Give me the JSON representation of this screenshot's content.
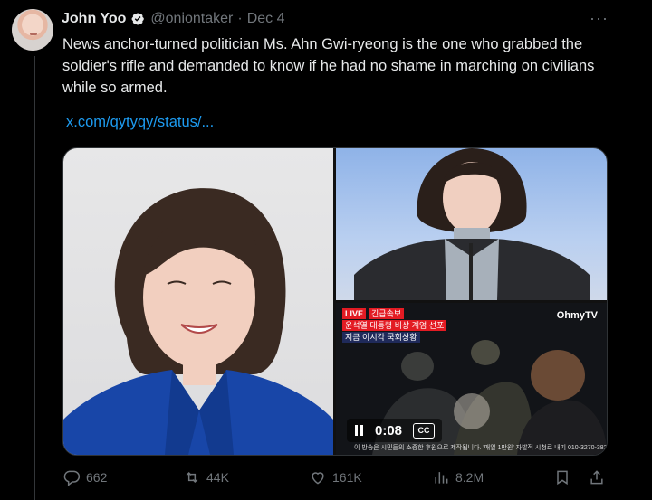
{
  "tweet": {
    "display_name": "John Yoo",
    "handle": "@oniontaker",
    "separator": "·",
    "date": "Dec 4",
    "more_label": "···",
    "text": "News anchor-turned politician Ms. Ahn Gwi-ryeong is the one who grabbed the soldier's rifle and demanded to know if he had no shame in marching on civilians while so armed.",
    "link": "x.com/qytyqy/status/..."
  },
  "media": {
    "broadcast": {
      "live_label": "LIVE",
      "breaking_label": "긴급속보",
      "headline": "윤석열 대통령 비상 계엄 선포",
      "subline": "지금 이시각 국회상황",
      "channel": "OhmyTV",
      "ticker": "이 방송은 시민들의 소중한 후원으로 제작됩니다. '매일 1만원' 자발적 시청료 내기 010-3270-3828"
    },
    "video": {
      "time": "0:08",
      "cc_label": "CC"
    }
  },
  "actions": {
    "replies": "662",
    "reposts": "44K",
    "likes": "161K",
    "views": "8.2M"
  },
  "colors": {
    "background": "#000000",
    "text": "#e7e9ea",
    "muted": "#71767b",
    "link": "#1d9bf0",
    "live_red": "#e31b23"
  },
  "icons": [
    "verified-badge-icon",
    "more-icon",
    "pause-icon",
    "cc-icon",
    "reply-icon",
    "repost-icon",
    "like-icon",
    "views-icon",
    "bookmark-icon",
    "share-icon"
  ]
}
